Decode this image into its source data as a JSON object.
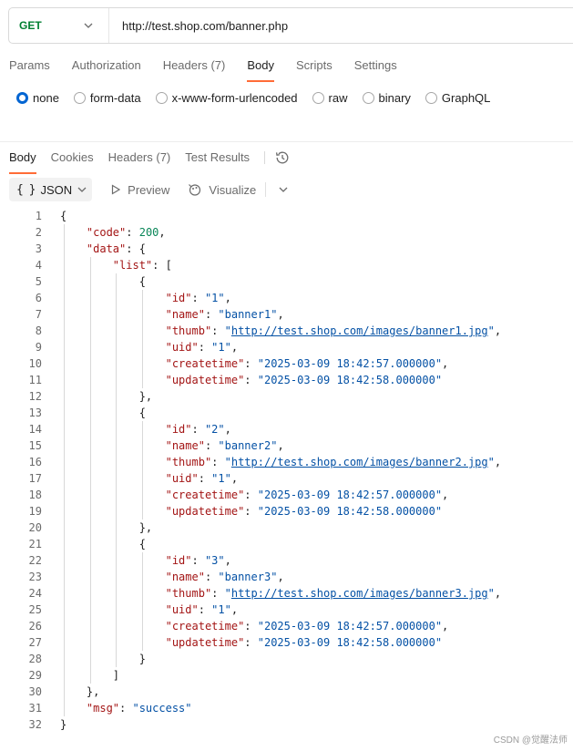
{
  "request": {
    "method": "GET",
    "url": "http://test.shop.com/banner.php"
  },
  "request_tabs": [
    {
      "label": "Params",
      "count": ""
    },
    {
      "label": "Authorization",
      "count": ""
    },
    {
      "label": "Headers",
      "count": "(7)"
    },
    {
      "label": "Body",
      "count": "",
      "active": true
    },
    {
      "label": "Scripts",
      "count": ""
    },
    {
      "label": "Settings",
      "count": ""
    }
  ],
  "body_types": [
    {
      "label": "none",
      "selected": true
    },
    {
      "label": "form-data"
    },
    {
      "label": "x-www-form-urlencoded"
    },
    {
      "label": "raw"
    },
    {
      "label": "binary"
    },
    {
      "label": "GraphQL"
    }
  ],
  "response_tabs": [
    {
      "label": "Body",
      "active": true
    },
    {
      "label": "Cookies"
    },
    {
      "label": "Headers (7)"
    },
    {
      "label": "Test Results"
    }
  ],
  "toolbar": {
    "format": "JSON",
    "preview_label": "Preview",
    "visualize_label": "Visualize"
  },
  "response_json": {
    "code": "200",
    "msg": "success",
    "list": [
      {
        "id": "1",
        "name": "banner1",
        "thumb": "http://test.shop.com/images/banner1.jpg",
        "uid": "1",
        "createtime": "2025-03-09 18:42:57.000000",
        "updatetime": "2025-03-09 18:42:58.000000"
      },
      {
        "id": "2",
        "name": "banner2",
        "thumb": "http://test.shop.com/images/banner2.jpg",
        "uid": "1",
        "createtime": "2025-03-09 18:42:57.000000",
        "updatetime": "2025-03-09 18:42:58.000000"
      },
      {
        "id": "3",
        "name": "banner3",
        "thumb": "http://test.shop.com/images/banner3.jpg",
        "uid": "1",
        "createtime": "2025-03-09 18:42:57.000000",
        "updatetime": "2025-03-09 18:42:58.000000"
      }
    ]
  },
  "watermark": "CSDN @觉醒法师",
  "colors": {
    "method": "#007f31",
    "active_tab_underline": "#ff6c37",
    "radio_selected": "#0265d2",
    "json_key": "#a31515",
    "json_string": "#0451a5",
    "json_number": "#098658"
  }
}
